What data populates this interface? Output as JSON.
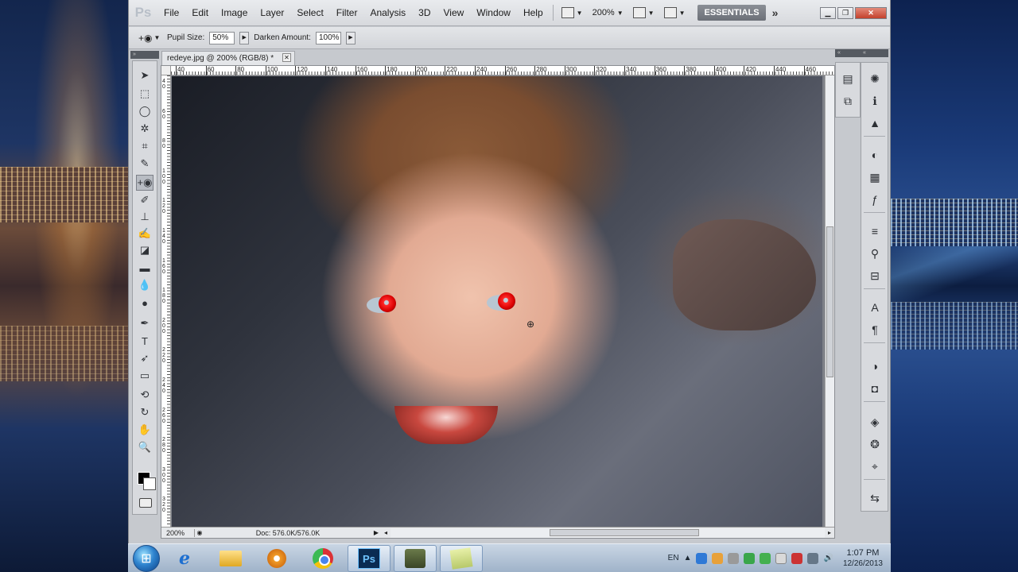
{
  "app": {
    "logo": "Ps",
    "menu": [
      "File",
      "Edit",
      "Image",
      "Layer",
      "Select",
      "Filter",
      "Analysis",
      "3D",
      "View",
      "Window",
      "Help"
    ],
    "zoom_display": "200%",
    "workspace": "ESSENTIALS",
    "more_workspaces": "»"
  },
  "options": {
    "pupil_size_label": "Pupil Size:",
    "pupil_size_value": "50%",
    "darken_amount_label": "Darken Amount:",
    "darken_amount_value": "100%"
  },
  "document": {
    "tab_title": "redeye.jpg @ 200% (RGB/8) *",
    "ruler_ticks": [
      "40",
      "60",
      "80",
      "100",
      "120",
      "140",
      "160",
      "180",
      "200",
      "220",
      "240",
      "260",
      "280",
      "300",
      "320",
      "340",
      "360",
      "380",
      "400",
      "420",
      "440",
      "460"
    ],
    "vruler_ticks": [
      "40",
      "60",
      "80",
      "100",
      "120",
      "140",
      "160",
      "180",
      "200",
      "220",
      "240",
      "260",
      "280",
      "300",
      "320"
    ],
    "status_zoom": "200%",
    "doc_info": "Doc: 576.0K/576.0K"
  },
  "taskbar": {
    "apps": [
      "ie-icon",
      "explorer-icon",
      "media-player-icon",
      "chrome-icon",
      "photoshop-icon",
      "camtasia-icon",
      "sticky-notes-icon"
    ],
    "language": "EN",
    "time": "1:07 PM",
    "date": "12/26/2013"
  }
}
